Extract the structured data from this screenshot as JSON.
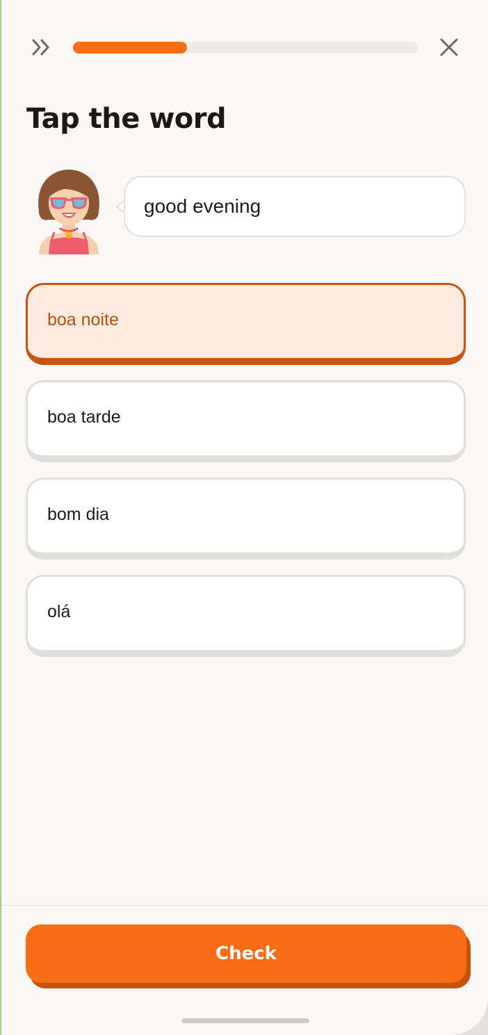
{
  "header": {
    "progress_fraction": 0.33,
    "skip_icon": "double-chevron-right-icon",
    "close_icon": "close-icon"
  },
  "exercise": {
    "title": "Tap the word",
    "prompt": "good evening",
    "avatar": "woman-with-sunglasses-avatar"
  },
  "options": [
    {
      "label": "boa noite",
      "selected": true
    },
    {
      "label": "boa tarde",
      "selected": false
    },
    {
      "label": "bom dia",
      "selected": false
    },
    {
      "label": "olá",
      "selected": false
    }
  ],
  "footer": {
    "check_label": "Check"
  },
  "colors": {
    "accent": "#f96d15",
    "accent_dark": "#c7520f",
    "selected_bg": "#fdebdf",
    "selected_text": "#b5520f",
    "background": "#f9f8f6"
  }
}
